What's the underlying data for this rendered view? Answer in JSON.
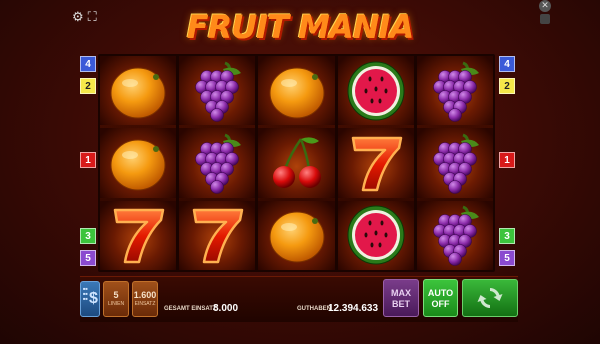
{
  "title": "FRUIT MANIA",
  "icons": {
    "settings": "gear-icon",
    "fullscreen": "fullscreen-icon",
    "close": "close-icon",
    "window": "window-icon"
  },
  "reels": [
    [
      "orange",
      "orange",
      "seven"
    ],
    [
      "grapes",
      "grapes",
      "seven"
    ],
    [
      "orange",
      "cherries",
      "orange"
    ],
    [
      "watermelon",
      "seven",
      "watermelon"
    ],
    [
      "grapes",
      "grapes",
      "grapes"
    ]
  ],
  "paylines_left": [
    {
      "label": "4",
      "color": "#3a5ad8",
      "text_color": "#ffffff"
    },
    {
      "label": "2",
      "color": "#f5e84a",
      "text_color": "#222222"
    },
    {
      "label": "1",
      "color": "#d81a1a",
      "text_color": "#ffffff"
    },
    {
      "label": "3",
      "color": "#3cc43c",
      "text_color": "#ffffff"
    },
    {
      "label": "5",
      "color": "#8a4ad0",
      "text_color": "#ffffff"
    }
  ],
  "paylines_right": [
    {
      "label": "4",
      "color": "#3a5ad8",
      "text_color": "#ffffff"
    },
    {
      "label": "2",
      "color": "#f5e84a",
      "text_color": "#222222"
    },
    {
      "label": "1",
      "color": "#d81a1a",
      "text_color": "#ffffff"
    },
    {
      "label": "3",
      "color": "#3cc43c",
      "text_color": "#ffffff"
    },
    {
      "label": "5",
      "color": "#8a4ad0",
      "text_color": "#ffffff"
    }
  ],
  "controls": {
    "bet_symbol": "$",
    "lines_value": "5",
    "lines_label": "LINIEN",
    "stake_value": "1.600",
    "stake_label": "EINSATZ",
    "total_bet_label": "GESAMT EINSATZ",
    "total_bet_value": "8.000",
    "balance_label": "GUTHABEN",
    "balance_value": "12.394.633",
    "maxbet_line1": "MAX",
    "maxbet_line2": "BET",
    "auto_line1": "AUTO",
    "auto_line2": "OFF"
  }
}
